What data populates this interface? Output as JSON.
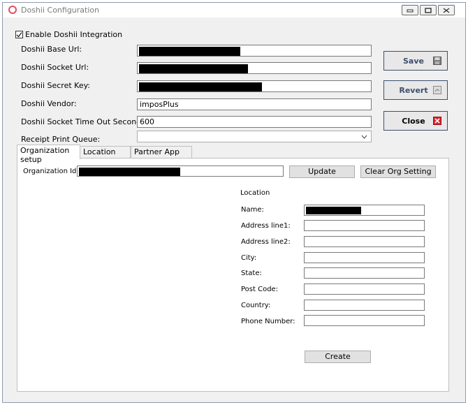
{
  "window": {
    "title": "Doshii Configuration"
  },
  "enable_integration": {
    "label": "Enable Doshii Integration",
    "checked": true
  },
  "fields": {
    "base_url": {
      "label": "Doshii Base Url:",
      "value": ""
    },
    "socket_url": {
      "label": "Doshii Socket Url:",
      "value": ""
    },
    "secret_key": {
      "label": "Doshii Secret Key:",
      "value": ""
    },
    "vendor": {
      "label": "Doshii Vendor:",
      "value": "imposPlus"
    },
    "socket_timeout": {
      "label": "Doshii Socket Time Out Seconds:",
      "value": "600"
    },
    "receipt_queue": {
      "label": "Receipt Print Queue:",
      "value": ""
    }
  },
  "side_buttons": {
    "save": "Save",
    "revert": "Revert",
    "close": "Close"
  },
  "tabs": [
    {
      "label": "Organization setup",
      "active": true
    },
    {
      "label": "Location setup",
      "active": false
    },
    {
      "label": "Partner App setup",
      "active": false
    }
  ],
  "org": {
    "id_label": "Organization Id:",
    "id_value": "",
    "update_label": "Update",
    "clear_label": "Clear Org Setting"
  },
  "location": {
    "heading": "Location",
    "fields": [
      {
        "label": "Name:",
        "value": ""
      },
      {
        "label": "Address line1:",
        "value": ""
      },
      {
        "label": "Address line2:",
        "value": ""
      },
      {
        "label": "City:",
        "value": ""
      },
      {
        "label": "State:",
        "value": ""
      },
      {
        "label": "Post Code:",
        "value": ""
      },
      {
        "label": "Country:",
        "value": ""
      },
      {
        "label": "Phone Number:",
        "value": ""
      }
    ],
    "create_label": "Create"
  },
  "colors": {
    "accent": "#3c4f6e",
    "close_icon": "#d9232e",
    "app_icon": "#e0505e"
  }
}
